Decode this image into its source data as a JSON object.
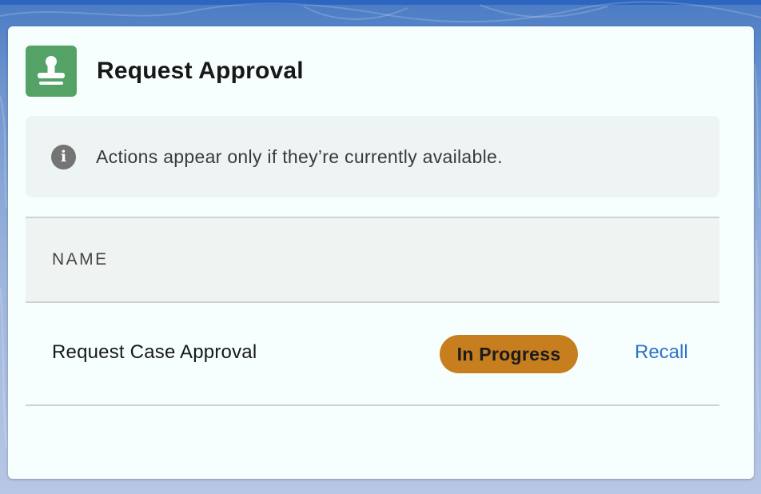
{
  "card": {
    "title": "Request Approval",
    "icon": "approval-stamp-icon"
  },
  "info": {
    "icon": "info-icon",
    "icon_glyph": "i",
    "text": "Actions appear only if they’re currently available."
  },
  "table": {
    "columns": [
      "NAME"
    ],
    "rows": [
      {
        "name": "Request Case Approval",
        "status": "In Progress",
        "action": "Recall"
      }
    ]
  },
  "colors": {
    "icon_bg": "#54a265",
    "status_badge": "#c67e1e",
    "link": "#2f74c4",
    "card_bg": "#f7fefe"
  }
}
